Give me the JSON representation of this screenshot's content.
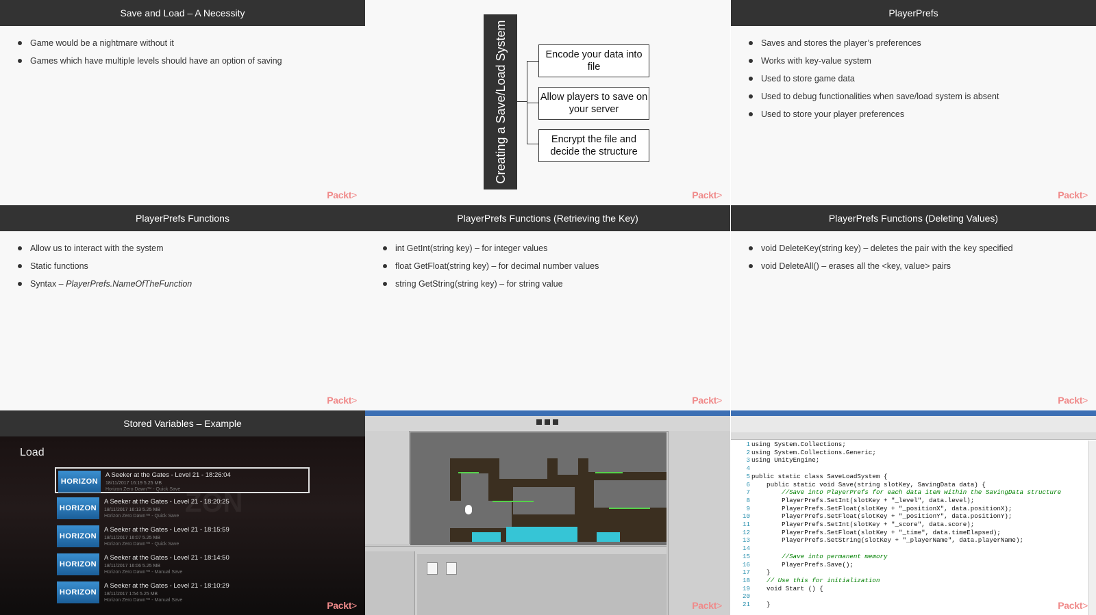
{
  "brand": {
    "logo_text": "Packt",
    "logo_suffix": ">",
    "color": "#f08a8a"
  },
  "slides": {
    "save_load": {
      "title": "Save and Load – A Necessity",
      "bullets": [
        "Game would be a nightmare without it",
        "Games which have multiple levels should have an option of saving"
      ]
    },
    "diagram": {
      "bar_label": "Creating a Save/Load System",
      "boxes": [
        "Encode your data into file",
        "Allow players to save on your server",
        "Encrypt the file and decide the structure"
      ]
    },
    "playerprefs": {
      "title": "PlayerPrefs",
      "bullets": [
        "Saves and stores the player’s preferences",
        "Works with key-value system",
        "Used to store game data",
        "Used to debug functionalities when save/load system is absent",
        "Used to store your player preferences"
      ]
    },
    "functions": {
      "title": "PlayerPrefs Functions",
      "bullets": [
        "Allow us to interact with the system",
        "Static functions"
      ],
      "syntax_label": "Syntax – ",
      "syntax_value": "PlayerPrefs.NameOfTheFunction"
    },
    "retrieving": {
      "title": "PlayerPrefs Functions (Retrieving the Key)",
      "bullets": [
        "int GetInt(string key) – for integer values",
        "float GetFloat(string key) – for decimal number values",
        "string GetString(string key) – for string value"
      ]
    },
    "deleting": {
      "title": "PlayerPrefs Functions (Deleting Values)",
      "bullets": [
        "void DeleteKey(string key) – deletes the pair with the key specified",
        "void DeleteAll() – erases all the <key, value> pairs"
      ]
    },
    "stored": {
      "title": "Stored Variables – Example",
      "load_label": "Load",
      "thumb_text": "HORIZON",
      "saves": [
        {
          "title": "A Seeker at the Gates - Level 21 - 18:26:04",
          "meta": "18/11/2017   16:19   5.25 MB",
          "game": "Horizon Zero Dawn™ - Quick Save",
          "selected": true
        },
        {
          "title": "A Seeker at the Gates - Level 21 - 18:20:25",
          "meta": "18/11/2017   16:13   5.25 MB",
          "game": "Horizon Zero Dawn™ - Quick Save",
          "selected": false
        },
        {
          "title": "A Seeker at the Gates - Level 21 - 18:15:59",
          "meta": "18/11/2017   16:07   5.25 MB",
          "game": "Horizon Zero Dawn™ - Quick Save",
          "selected": false
        },
        {
          "title": "A Seeker at the Gates - Level 21 - 18:14:50",
          "meta": "18/11/2017   16:06   5.25 MB",
          "game": "Horizon Zero Dawn™ - Manual Save",
          "selected": false
        },
        {
          "title": "A Seeker at the Gates - Level 21 - 18:10:29",
          "meta": "18/11/2017   1:54   5.25 MB",
          "game": "Horizon Zero Dawn™ - Manual Save",
          "selected": false
        }
      ]
    },
    "code": {
      "lines": [
        {
          "n": "1",
          "t": "using System.Collections;"
        },
        {
          "n": "2",
          "t": "using System.Collections.Generic;"
        },
        {
          "n": "3",
          "t": "using UnityEngine;"
        },
        {
          "n": "4",
          "t": ""
        },
        {
          "n": "5",
          "t": "public static class SaveLoadSystem {"
        },
        {
          "n": "6",
          "t": "    public static void Save(string slotKey, SavingData data) {"
        },
        {
          "n": "7",
          "t": "        //Save into PlayerPrefs for each data item within the SavingData structure"
        },
        {
          "n": "8",
          "t": "        PlayerPrefs.SetInt(slotKey + \"_level\", data.level);"
        },
        {
          "n": "9",
          "t": "        PlayerPrefs.SetFloat(slotKey + \"_positionX\", data.positionX);"
        },
        {
          "n": "10",
          "t": "        PlayerPrefs.SetFloat(slotKey + \"_positionY\", data.positionY);"
        },
        {
          "n": "11",
          "t": "        PlayerPrefs.SetInt(slotKey + \"_score\", data.score);"
        },
        {
          "n": "12",
          "t": "        PlayerPrefs.SetFloat(slotKey + \"_time\", data.timeElapsed);"
        },
        {
          "n": "13",
          "t": "        PlayerPrefs.SetString(slotKey + \"_playerName\", data.playerName);"
        },
        {
          "n": "14",
          "t": ""
        },
        {
          "n": "15",
          "t": "        //Save into permanent memory"
        },
        {
          "n": "16",
          "t": "        PlayerPrefs.Save();"
        },
        {
          "n": "17",
          "t": "    }"
        },
        {
          "n": "18",
          "t": "    // Use this for initialization"
        },
        {
          "n": "19",
          "t": "    void Start () {"
        },
        {
          "n": "20",
          "t": ""
        },
        {
          "n": "21",
          "t": "    }"
        }
      ]
    }
  }
}
